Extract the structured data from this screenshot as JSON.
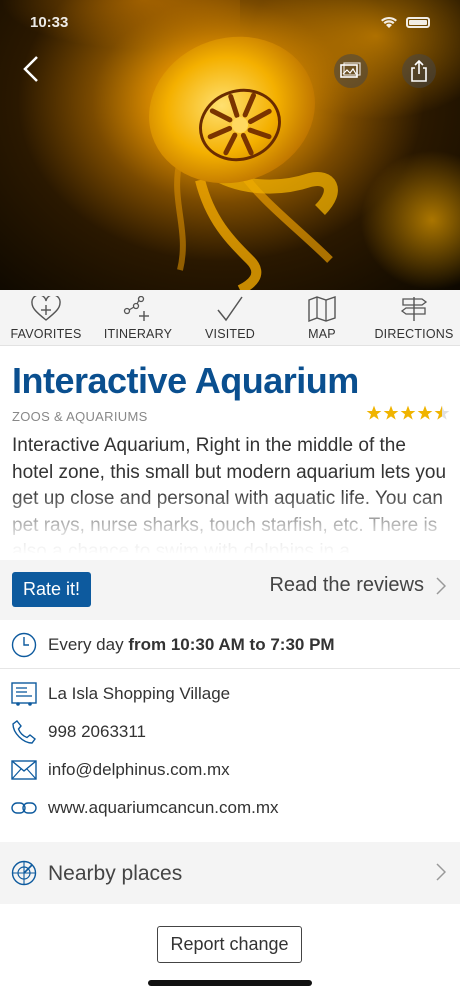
{
  "status_bar": {
    "time": "10:33"
  },
  "hero": {
    "image_desc_icon": "jellyfish-photo"
  },
  "actions": [
    {
      "label": "FAVORITES",
      "icon": "heart-plus-icon"
    },
    {
      "label": "ITINERARY",
      "icon": "itinerary-icon"
    },
    {
      "label": "VISITED",
      "icon": "checkmark-icon"
    },
    {
      "label": "MAP",
      "icon": "map-icon"
    },
    {
      "label": "DIRECTIONS",
      "icon": "signpost-icon"
    }
  ],
  "place": {
    "title": "Interactive Aquarium",
    "category": "ZOOS & AQUARIUMS",
    "rating": 4.5,
    "description": "Interactive Aquarium, Right in the middle of the hotel zone, this small but modern aquarium lets you get up close and personal with aquatic life. You can pet rays, nurse sharks, touch starfish, etc. There is also a chance to swim with dolphins in a"
  },
  "rate": {
    "button_label": "Rate it!",
    "reviews_label": "Read the reviews"
  },
  "info": {
    "hours_prefix": "Every day",
    "hours_value": "from 10:30 AM to 7:30 PM",
    "address": "La Isla Shopping Village",
    "phone": "998 2063311",
    "email": "info@delphinus.com.mx",
    "website": "www.aquariumcancun.com.mx"
  },
  "nearby": {
    "label": "Nearby places"
  },
  "report": {
    "label": "Report change"
  },
  "colors": {
    "accent": "#0a4f8f",
    "button": "#0d5a9e",
    "star": "#f0b400"
  }
}
